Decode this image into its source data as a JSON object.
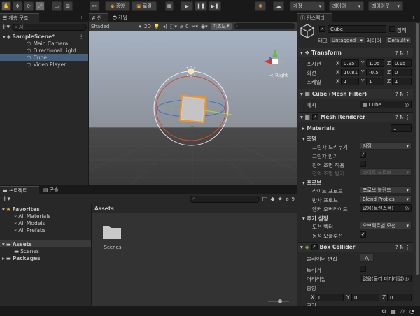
{
  "toolbar": {
    "tool_icons": [
      "hand-icon",
      "move-icon",
      "rotate-icon",
      "scale-icon",
      "rect-icon",
      "transform-icon",
      "custom-tool-icon"
    ],
    "pivot_label": "중앙",
    "local_label": "로컬",
    "account_label": "계정",
    "layers_label": "레이어",
    "layout_label": "레이아웃"
  },
  "hierarchy": {
    "tab_label": "계층 구조",
    "search_placeholder": "All",
    "scene_name": "SampleScene*",
    "items": [
      {
        "label": "Main Camera"
      },
      {
        "label": "Directional Light"
      },
      {
        "label": "Cube"
      },
      {
        "label": "Video Player"
      }
    ]
  },
  "scene_view": {
    "tab_scene": "씬",
    "tab_game": "게임",
    "shading_mode": "Shaded",
    "mode_2d": "2D",
    "gizmos_label": "기즈모",
    "search_placeholder": "All",
    "orientation_label": "< Right",
    "hidden_count": "0"
  },
  "project": {
    "tab_project": "프로젝트",
    "tab_console": "콘솔",
    "favorites_label": "Favorites",
    "favorites_items": [
      "All Materials",
      "All Models",
      "All Prefabs"
    ],
    "assets_label": "Assets",
    "assets_children": [
      "Scenes"
    ],
    "packages_label": "Packages",
    "breadcrumb": "Assets",
    "folder_name": "Scenes",
    "hidden_count": "9"
  },
  "inspector": {
    "tab_label": "인스펙터",
    "object_name": "Cube",
    "static_label": "정적",
    "tag_label": "태그",
    "tag_value": "Untagged",
    "layer_label": "레이어",
    "layer_value": "Default",
    "transform": {
      "title": "Transform",
      "position_label": "포지션",
      "rotation_label": "회전",
      "scale_label": "스케일",
      "position": {
        "x": "0.95",
        "y": "1.05",
        "z": "0.15"
      },
      "rotation": {
        "x": "10.81",
        "y": "-0.5",
        "z": "0"
      },
      "scale": {
        "x": "1",
        "y": "1",
        "z": "1"
      }
    },
    "mesh_filter": {
      "title": "Cube (Mesh Filter)",
      "mesh_label": "메시",
      "mesh_value": "Cube"
    },
    "mesh_renderer": {
      "title": "Mesh Renderer",
      "materials_label": "Materials",
      "materials_count": "1",
      "lighting_label": "조명",
      "cast_shadows_label": "그림자 드리우기",
      "cast_shadows_value": "켜짐",
      "receive_shadows_label": "그림자 받기",
      "contribute_gi_label": "전역 조명 적용",
      "receive_gi_label": "전역 조명 받기",
      "receive_gi_value": "라이트 프로브",
      "probes_label": "프로브",
      "light_probes_label": "라이트 프로브",
      "light_probes_value": "프로브 블렌드",
      "reflection_probes_label": "반사 프로브",
      "reflection_probes_value": "Blend Probes",
      "anchor_override_label": "앵커 오버라이드",
      "anchor_override_value": "없음(트랜스폼)",
      "additional_label": "추가 설정",
      "motion_vectors_label": "모션 벡터",
      "motion_vectors_value": "오브젝트별 모션",
      "dynamic_occlusion_label": "동적 오클루전"
    },
    "box_collider": {
      "title": "Box Collider",
      "edit_collider_label": "콜라이더 편집",
      "trigger_label": "트리거",
      "material_label": "머티리얼",
      "material_value": "없음(물리 머티리얼)",
      "center_label": "중앙",
      "center": {
        "x": "0",
        "y": "0",
        "z": "0"
      },
      "size_label": "크기"
    }
  },
  "colors": {
    "selection": "#2c5d87",
    "accent_orange": "#f7931e",
    "sky": "#9aa6b8",
    "ground": "#414141"
  }
}
